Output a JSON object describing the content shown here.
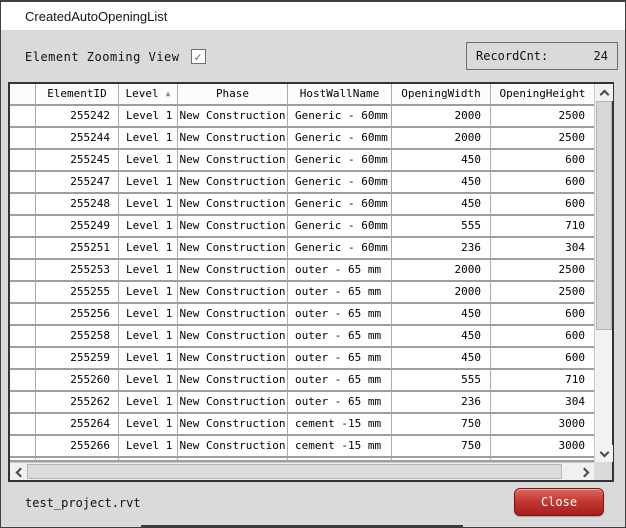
{
  "window": {
    "title": "CreatedAutoOpeningList"
  },
  "controls": {
    "zoom_view_label": "Element Zooming View",
    "zoom_view_checked": true,
    "check_glyph": "✓",
    "record_count_label": "RecordCnt:",
    "record_count_value": "24"
  },
  "table": {
    "columns": [
      "ElementID",
      "Level",
      "Phase",
      "HostWallName",
      "OpeningWidth",
      "OpeningHeight"
    ],
    "sort": {
      "column": "Level",
      "direction": "ascending",
      "arrow_glyph": "▲"
    },
    "rows": [
      [
        "255242",
        "Level 1",
        "New Construction",
        "Generic - 60mm",
        "2000",
        "2500"
      ],
      [
        "255244",
        "Level 1",
        "New Construction",
        "Generic - 60mm",
        "2000",
        "2500"
      ],
      [
        "255245",
        "Level 1",
        "New Construction",
        "Generic - 60mm",
        "450",
        "600"
      ],
      [
        "255247",
        "Level 1",
        "New Construction",
        "Generic - 60mm",
        "450",
        "600"
      ],
      [
        "255248",
        "Level 1",
        "New Construction",
        "Generic - 60mm",
        "450",
        "600"
      ],
      [
        "255249",
        "Level 1",
        "New Construction",
        "Generic - 60mm",
        "555",
        "710"
      ],
      [
        "255251",
        "Level 1",
        "New Construction",
        "Generic - 60mm",
        "236",
        "304"
      ],
      [
        "255253",
        "Level 1",
        "New Construction",
        "outer - 65 mm",
        "2000",
        "2500"
      ],
      [
        "255255",
        "Level 1",
        "New Construction",
        "outer - 65 mm",
        "2000",
        "2500"
      ],
      [
        "255256",
        "Level 1",
        "New Construction",
        "outer - 65 mm",
        "450",
        "600"
      ],
      [
        "255258",
        "Level 1",
        "New Construction",
        "outer - 65 mm",
        "450",
        "600"
      ],
      [
        "255259",
        "Level 1",
        "New Construction",
        "outer - 65 mm",
        "450",
        "600"
      ],
      [
        "255260",
        "Level 1",
        "New Construction",
        "outer - 65 mm",
        "555",
        "710"
      ],
      [
        "255262",
        "Level 1",
        "New Construction",
        "outer - 65 mm",
        "236",
        "304"
      ],
      [
        "255264",
        "Level 1",
        "New Construction",
        "cement -15 mm",
        "750",
        "3000"
      ],
      [
        "255266",
        "Level 1",
        "New Construction",
        "cement -15 mm",
        "750",
        "3000"
      ]
    ]
  },
  "footer": {
    "file_name": "test_project.rvt",
    "close_label": "Close"
  },
  "colors": {
    "dialog_bg": "#dadada",
    "titlebar_bg": "#ffffff",
    "grid_line": "#9e9e9e",
    "close_gradient_top": "#da6a61",
    "close_gradient_bottom": "#a81d1d",
    "close_border": "#7e1414"
  }
}
